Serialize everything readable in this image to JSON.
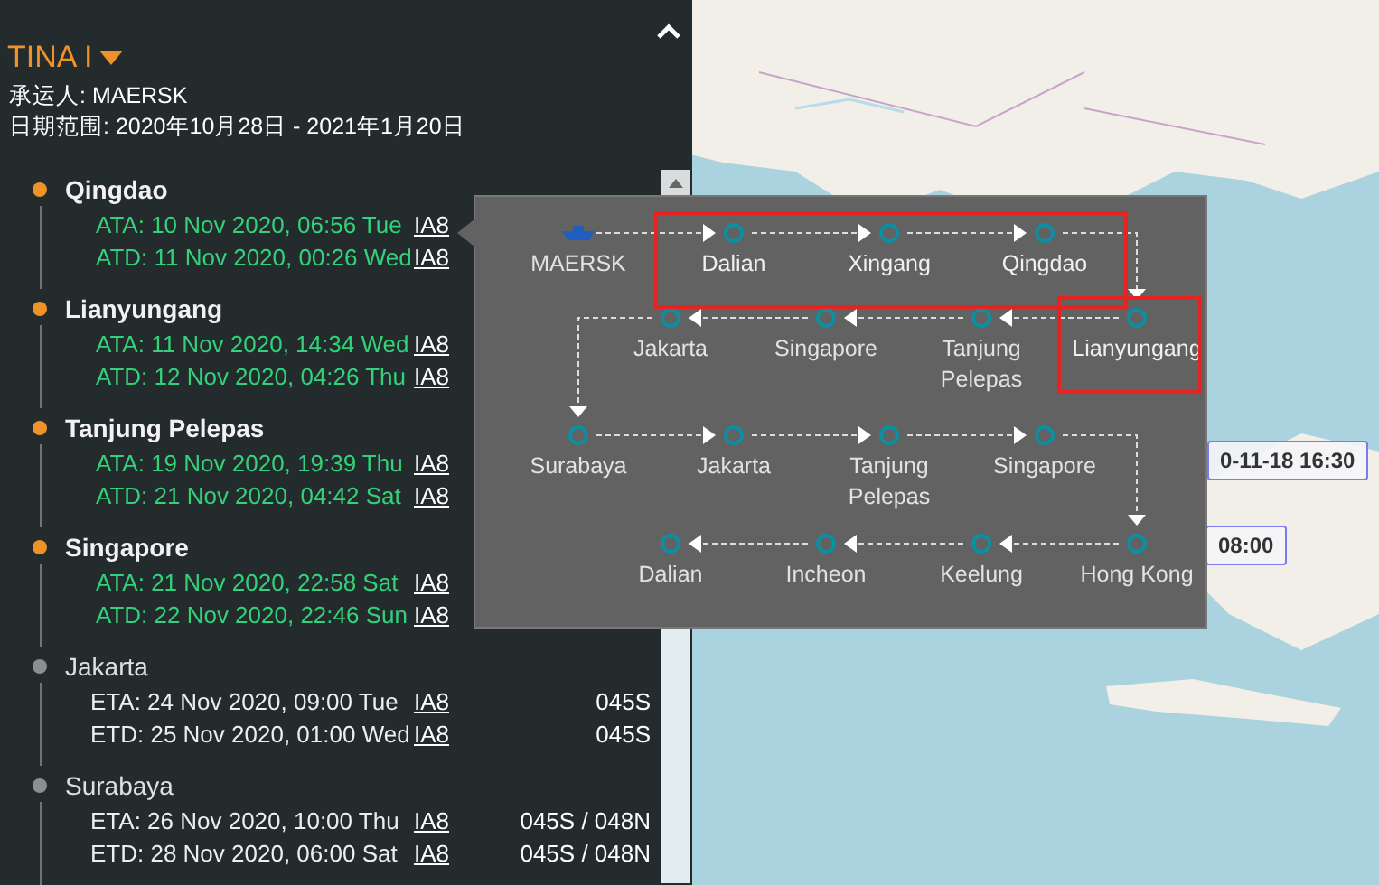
{
  "vessel": {
    "name": "TINA I"
  },
  "carrier": "承运人: MAERSK",
  "date_range": "日期范围: 2020年10月28日 - 2021年1月20日",
  "stops": [
    {
      "port": "Qingdao",
      "completed": true,
      "events": [
        {
          "text": "ATA: 10 Nov 2020, 06:56 Tue",
          "service": "IA8"
        },
        {
          "text": "ATD: 11 Nov 2020, 00:26 Wed",
          "service": "IA8"
        }
      ]
    },
    {
      "port": "Lianyungang",
      "completed": true,
      "events": [
        {
          "text": "ATA: 11 Nov 2020, 14:34 Wed",
          "service": "IA8"
        },
        {
          "text": "ATD: 12 Nov 2020, 04:26 Thu",
          "service": "IA8"
        }
      ]
    },
    {
      "port": "Tanjung Pelepas",
      "completed": true,
      "events": [
        {
          "text": "ATA: 19 Nov 2020, 19:39 Thu",
          "service": "IA8"
        },
        {
          "text": "ATD: 21 Nov 2020, 04:42 Sat",
          "service": "IA8"
        }
      ]
    },
    {
      "port": "Singapore",
      "completed": true,
      "events": [
        {
          "text": "ATA: 21 Nov 2020, 22:58 Sat",
          "service": "IA8"
        },
        {
          "text": "ATD: 22 Nov 2020, 22:46 Sun",
          "service": "IA8"
        }
      ]
    },
    {
      "port": "Jakarta",
      "completed": false,
      "events": [
        {
          "text": "ETA: 24 Nov 2020, 09:00 Tue",
          "service": "IA8",
          "voyage": "045S"
        },
        {
          "text": "ETD: 25 Nov 2020, 01:00 Wed",
          "service": "IA8",
          "voyage": "045S"
        }
      ]
    },
    {
      "port": "Surabaya",
      "completed": false,
      "events": [
        {
          "text": "ETA: 26 Nov 2020, 10:00 Thu",
          "service": "IA8",
          "voyage": "045S / 048N"
        },
        {
          "text": "ETD: 28 Nov 2020, 06:00 Sat",
          "service": "IA8",
          "voyage": "045S / 048N"
        }
      ]
    }
  ],
  "route_popup": {
    "rows": [
      {
        "reversed": false,
        "nodes": [
          {
            "label": "MAERSK",
            "kind": "ship",
            "highlighted": false
          },
          {
            "label": "Dalian",
            "kind": "port",
            "highlighted": true
          },
          {
            "label": "Xingang",
            "kind": "port",
            "highlighted": true
          },
          {
            "label": "Qingdao",
            "kind": "port",
            "highlighted": true
          }
        ]
      },
      {
        "reversed": true,
        "nodes": [
          {
            "label": "Jakarta",
            "kind": "port",
            "highlighted": false
          },
          {
            "label": "Singapore",
            "kind": "port",
            "highlighted": false
          },
          {
            "label": "Tanjung Pelepas",
            "kind": "port",
            "highlighted": false
          },
          {
            "label": "Lianyungang",
            "kind": "port",
            "highlighted": true
          }
        ]
      },
      {
        "reversed": false,
        "nodes": [
          {
            "label": "Surabaya",
            "kind": "port",
            "highlighted": false
          },
          {
            "label": "Jakarta",
            "kind": "port",
            "highlighted": false
          },
          {
            "label": "Tanjung Pelepas",
            "kind": "port",
            "highlighted": false
          },
          {
            "label": "Singapore",
            "kind": "port",
            "highlighted": false
          }
        ]
      },
      {
        "reversed": true,
        "nodes": [
          {
            "label": "Dalian",
            "kind": "port",
            "highlighted": false
          },
          {
            "label": "Incheon",
            "kind": "port",
            "highlighted": false
          },
          {
            "label": "Keelung",
            "kind": "port",
            "highlighted": false
          },
          {
            "label": "Hong Kong",
            "kind": "port",
            "highlighted": false
          }
        ]
      }
    ]
  },
  "map_markers": [
    {
      "text": "0-11-18 16:30"
    },
    {
      "text": "08:00"
    }
  ]
}
